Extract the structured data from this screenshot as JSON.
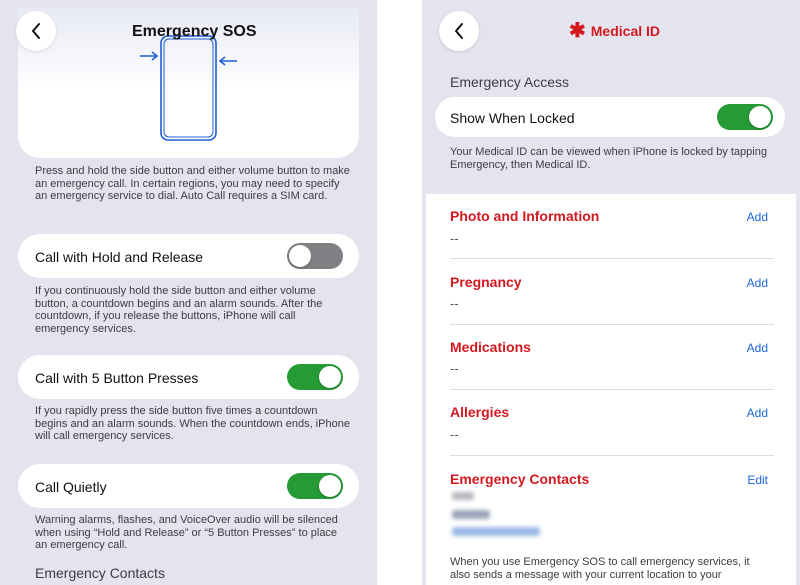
{
  "left": {
    "title": "Emergency SOS",
    "diagram_caption": "Press and hold the side button and either volume button to make an emergency call. In certain regions, you may need to specify an emergency service to dial. Auto Call requires a SIM card.",
    "rows": [
      {
        "label": "Call with Hold and Release",
        "toggle_on": false,
        "note": "If you continuously hold the side button and either volume button, a countdown begins and an alarm sounds. After the countdown, if you release the buttons, iPhone will call emergency services."
      },
      {
        "label": "Call with 5 Button Presses",
        "toggle_on": true,
        "note": "If you rapidly press the side button five times a countdown begins and an alarm sounds. When the countdown ends, iPhone will call emergency services."
      },
      {
        "label": "Call Quietly",
        "toggle_on": true,
        "note": "Warning alarms, flashes, and VoiceOver audio will be silenced when using “Hold and Release” or “5 Button Presses” to place an emergency call."
      }
    ],
    "bottom_section": "Emergency Contacts"
  },
  "right": {
    "title": "Medical ID",
    "title_icon": "asterisk-icon",
    "access_header": "Emergency Access",
    "show_when_locked": {
      "label": "Show When Locked",
      "toggle_on": true
    },
    "access_note": "Your Medical ID can be viewed when iPhone is locked by tapping Emergency, then Medical ID.",
    "sections": [
      {
        "title": "Photo and Information",
        "action": "Add",
        "value": "--"
      },
      {
        "title": "Pregnancy",
        "action": "Add",
        "value": "--"
      },
      {
        "title": "Medications",
        "action": "Add",
        "value": "--"
      },
      {
        "title": "Allergies",
        "action": "Add",
        "value": "--"
      },
      {
        "title": "Emergency Contacts",
        "action": "Edit",
        "value": ""
      }
    ],
    "footer_note": "When you use Emergency SOS to call emergency services, it also sends a message with your current location to your"
  },
  "colors": {
    "toggle_on": "#259a35",
    "toggle_off": "#7f7f84",
    "medical_red": "#d4181f",
    "link_blue": "#1a66d6",
    "diagram_blue": "#1f5fd0",
    "background": "#e4e4ef"
  }
}
